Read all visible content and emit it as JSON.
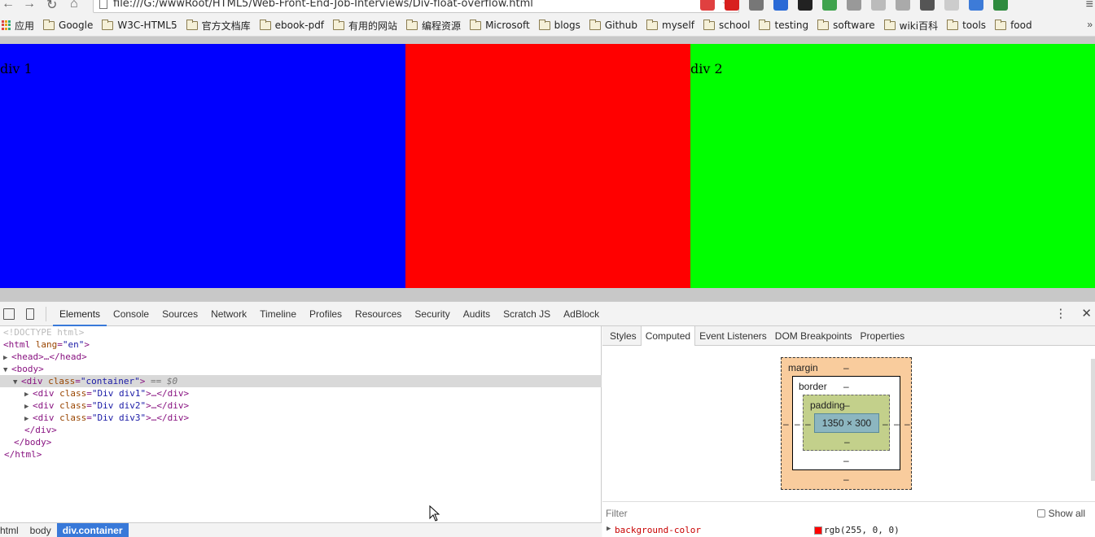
{
  "browser": {
    "url": "file:///G:/wwwRoot/HTML5/Web-Front-End-Job-Interviews/Div-float-overflow.html",
    "bookmarks": [
      "应用",
      "Google",
      "W3C-HTML5",
      "官方文档库",
      "ebook-pdf",
      "有用的网站",
      "编程资源",
      "Microsoft",
      "blogs",
      "Github",
      "myself",
      "school",
      "testing",
      "software",
      "wiki百科",
      "tools",
      "food"
    ],
    "more_bookmarks": "»"
  },
  "page": {
    "div1_text": "div 1",
    "div2_text": "div 2",
    "colors": {
      "div1": "#0000ff",
      "div3": "#ff0000",
      "div2": "#00ff00"
    }
  },
  "devtools": {
    "tabs": [
      "Elements",
      "Console",
      "Sources",
      "Network",
      "Timeline",
      "Profiles",
      "Resources",
      "Security",
      "Audits",
      "Scratch JS",
      "AdBlock"
    ],
    "active_tab": "Elements",
    "dom": {
      "doctype": "<!DOCTYPE html>",
      "html_open_tag": "<html",
      "html_lang_attr": "lang",
      "html_lang_val": "\"en\"",
      "head_collapsed": "<head>…</head>",
      "body_open": "<body>",
      "container_tag": "<div",
      "class_attr": "class",
      "container_class": "\"container\"",
      "selected_marker": "== $0",
      "children": [
        {
          "class_val": "\"Div div1\"",
          "rest": ">…</div>"
        },
        {
          "class_val": "\"Div div2\"",
          "rest": ">…</div>"
        },
        {
          "class_val": "\"Div div3\"",
          "rest": ">…</div>"
        }
      ],
      "div_close": "</div>",
      "body_close": "</body>",
      "html_close": "</html>"
    },
    "breadcrumbs": [
      "html",
      "body",
      "div.container"
    ],
    "sidebar_tabs": [
      "Styles",
      "Computed",
      "Event Listeners",
      "DOM Breakpoints",
      "Properties"
    ],
    "sidebar_active": "Computed",
    "box_model": {
      "margin_label": "margin",
      "border_label": "border",
      "padding_label": "padding",
      "dash": "–",
      "content_size": "1350 × 300"
    },
    "filter_placeholder": "Filter",
    "show_all_label": "Show all",
    "computed_property": {
      "name": "background-color",
      "value": "rgb(255, 0, 0)",
      "swatch": "#ff0000"
    }
  }
}
